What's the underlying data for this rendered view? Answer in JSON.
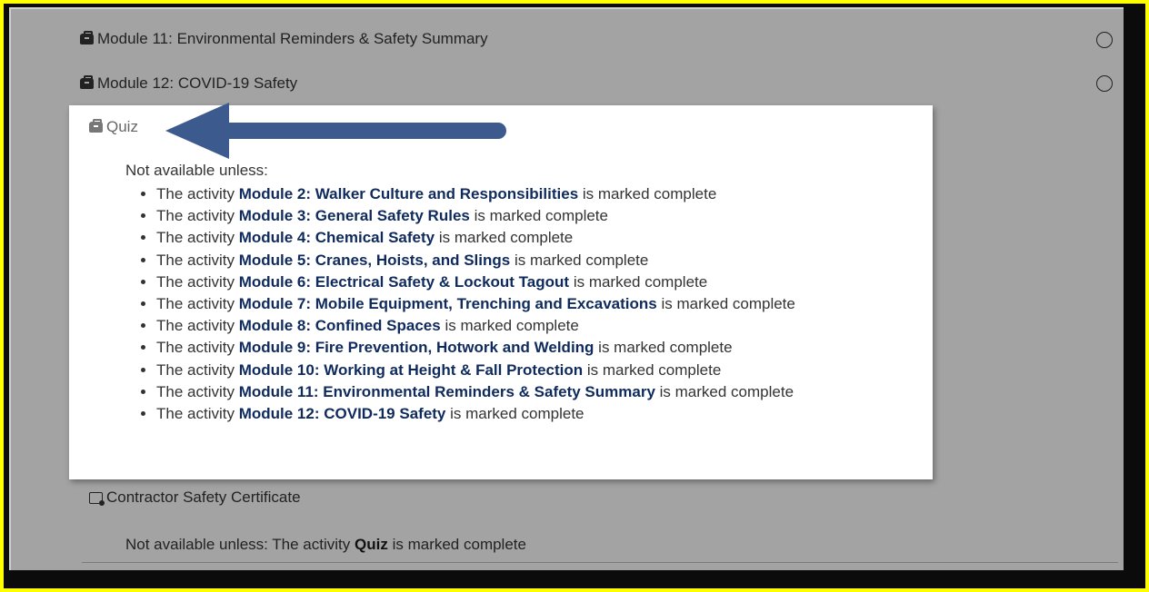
{
  "modules": [
    {
      "label": "Module 11: Environmental Reminders & Safety Summary"
    },
    {
      "label": "Module 12: COVID-19 Safety"
    }
  ],
  "quiz": {
    "label": "Quiz",
    "restriction_intro": "Not available unless:",
    "prefix": "The activity",
    "suffix": "is marked complete",
    "conditions": [
      "Module 2: Walker Culture and Responsibilities",
      "Module 3: General Safety Rules",
      "Module 4: Chemical Safety",
      "Module 5: Cranes, Hoists, and Slings",
      "Module 6: Electrical Safety & Lockout Tagout",
      "Module 7: Mobile Equipment, Trenching and Excavations",
      "Module 8: Confined Spaces",
      "Module 9: Fire Prevention, Hotwork and Welding",
      "Module 10: Working at Height & Fall Protection",
      "Module 11: Environmental Reminders & Safety Summary",
      "Module 12: COVID-19 Safety"
    ]
  },
  "certificate": {
    "label": "Contractor Safety Certificate",
    "note_prefix": "Not available unless: The activity",
    "note_activity": "Quiz",
    "note_suffix": "is marked complete"
  },
  "colors": {
    "frame_border": "#ffff00",
    "panel_bg": "#a3a3a3",
    "link": "#0f2a5c",
    "arrow": "#3d5a8f"
  }
}
